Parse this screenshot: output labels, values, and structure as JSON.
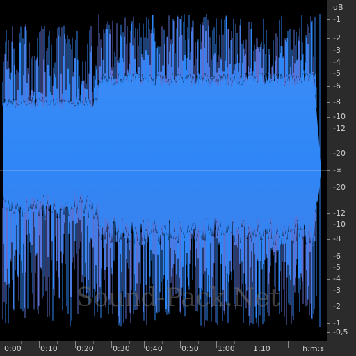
{
  "waveform": {
    "fill_color": "#2f86f6",
    "line_color": "#5f6fd0",
    "center_color": "#cfd6ff"
  },
  "db_ruler": {
    "unit_label": "dB",
    "labels": [
      "-1",
      "-2",
      "-3",
      "-4",
      "-5",
      "-6",
      "-8",
      "-10",
      "-12",
      "-20",
      "-∞",
      "-20",
      "-12",
      "-10",
      "-8",
      "-6",
      "-5",
      "-4",
      "-3",
      "-2",
      "-1",
      "-0,5"
    ]
  },
  "time_ruler": {
    "labels": [
      "0:00",
      "0:10",
      "0:20",
      "0:30",
      "0:40",
      "0:50",
      "1:00",
      "1:10"
    ],
    "unit_label": "h:m:s"
  },
  "watermark": {
    "text": "Sound-Pack.Net"
  }
}
